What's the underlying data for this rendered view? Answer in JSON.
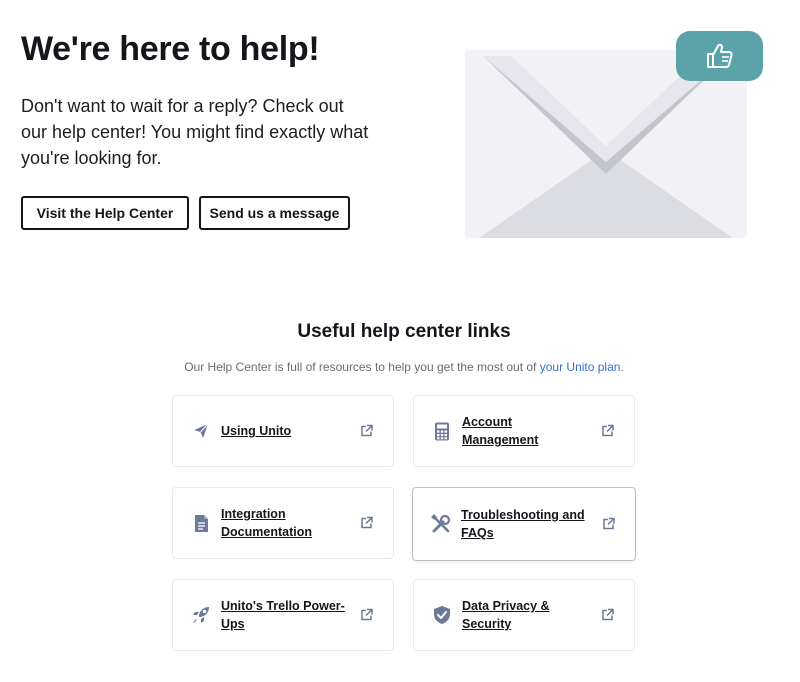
{
  "hero": {
    "title": "We're here to help!",
    "text": "Don't want to wait for a reply? Check out our help center! You might find exactly what you're looking for.",
    "buttons": {
      "help_center": "Visit the Help Center",
      "message": "Send us a message"
    }
  },
  "section": {
    "title": "Useful help center links",
    "subtitle_prefix": "Our Help Center is full of resources to help you get the most out of ",
    "subtitle_link": "your Unito plan",
    "subtitle_suffix": "."
  },
  "cards": [
    {
      "label": "Using Unito",
      "icon": "paper-plane-icon"
    },
    {
      "label": "Account Management",
      "icon": "calculator-icon"
    },
    {
      "label": "Integration Documentation",
      "icon": "document-icon"
    },
    {
      "label": "Troubleshooting and FAQs",
      "icon": "tools-icon"
    },
    {
      "label": "Unito's Trello Power-Ups",
      "icon": "rocket-icon"
    },
    {
      "label": "Data Privacy & Security",
      "icon": "shield-check-icon"
    }
  ],
  "colors": {
    "accent_teal": "#5aa4a9",
    "icon_slate": "#6b7a99",
    "link_blue": "#3b6fd0",
    "text_dark": "#16151b"
  }
}
